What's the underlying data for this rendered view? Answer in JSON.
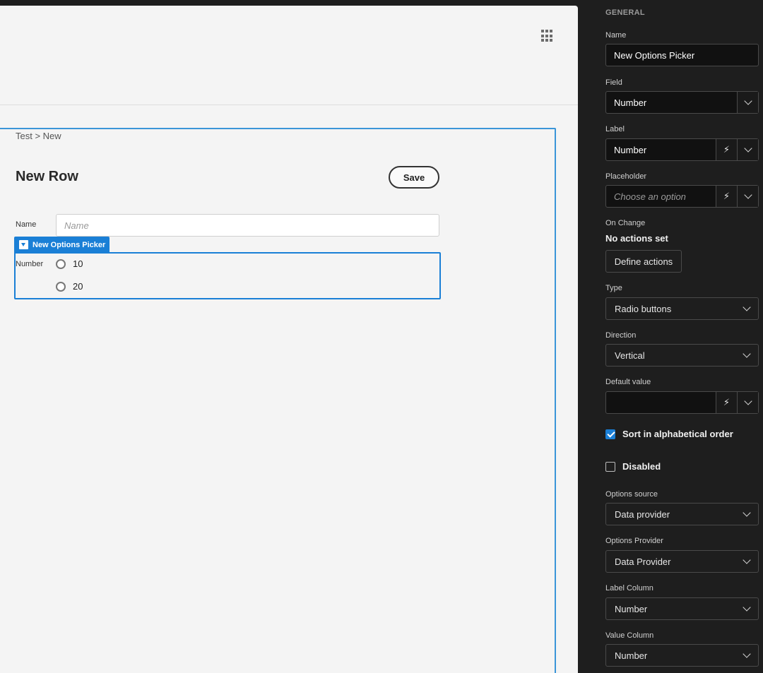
{
  "canvas": {
    "breadcrumb": "Test > New",
    "page_title": "New Row",
    "save_label": "Save",
    "name_field": {
      "label": "Name",
      "placeholder": "Name"
    },
    "picker": {
      "tag": "New Options Picker",
      "label": "Number",
      "options": [
        "10",
        "20"
      ]
    }
  },
  "panel": {
    "section": "GENERAL",
    "name": {
      "label": "Name",
      "value": "New Options Picker"
    },
    "field": {
      "label": "Field",
      "value": "Number"
    },
    "label_field": {
      "label": "Label",
      "value": "Number"
    },
    "placeholder_field": {
      "label": "Placeholder",
      "value": "Choose an option"
    },
    "on_change": {
      "label": "On Change",
      "status": "No actions set",
      "button": "Define actions"
    },
    "type": {
      "label": "Type",
      "value": "Radio buttons"
    },
    "direction": {
      "label": "Direction",
      "value": "Vertical"
    },
    "default_value": {
      "label": "Default value",
      "value": ""
    },
    "sort_alpha": {
      "label": "Sort in alphabetical order",
      "checked": true
    },
    "disabled": {
      "label": "Disabled",
      "checked": false
    },
    "options_source": {
      "label": "Options source",
      "value": "Data provider"
    },
    "options_provider": {
      "label": "Options Provider",
      "value": "Data Provider"
    },
    "label_column": {
      "label": "Label Column",
      "value": "Number"
    },
    "value_column": {
      "label": "Value Column",
      "value": "Number"
    }
  },
  "icons": [
    "apps-grid-icon",
    "dropdown-toggle-icon",
    "bolt-icon",
    "chevron-down-icon",
    "radio-icon",
    "checkbox-icon"
  ],
  "colors": {
    "accent": "#1a7fd6",
    "selection_frame": "#3a95d8",
    "panel_bg": "#1e1e1e",
    "canvas_bg": "#f4f4f4"
  }
}
